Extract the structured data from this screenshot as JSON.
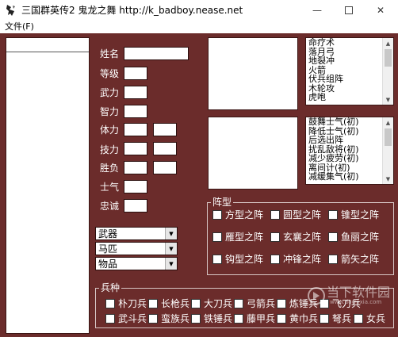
{
  "window": {
    "title": "三国群英传2 鬼龙之舞 http://k_badboy.nease.net",
    "minimize_glyph": "—",
    "close_glyph": "✕"
  },
  "menu": {
    "file_label": "文件(F)"
  },
  "stats": {
    "name_label": "姓名",
    "level_label": "等级",
    "force_label": "武力",
    "intel_label": "智力",
    "hp_label": "体力",
    "skill_label": "技力",
    "winloss_label": "胜负",
    "morale_label": "士气",
    "loyalty_label": "忠诚"
  },
  "combos": [
    {
      "value": "武器"
    },
    {
      "value": "马匹"
    },
    {
      "value": "物品"
    }
  ],
  "skills_list": [
    "命疗术",
    "落月弓",
    "地裂冲",
    "火箭",
    "伏兵组阵",
    "木轮攻",
    "虎咆"
  ],
  "morale_list": [
    "鼓舞士气(初)",
    "降低士气(初)",
    "后选出阵",
    "扰乱敌将(初)",
    "减少疲劳(初)",
    "离间计(初)",
    "减缓集气(初)"
  ],
  "formation": {
    "label": "阵型",
    "items": [
      "方型之阵",
      "圆型之阵",
      "锥型之阵",
      "雁型之阵",
      "玄襄之阵",
      "鱼丽之阵",
      "钩型之阵",
      "冲锋之阵",
      "箭矢之阵"
    ]
  },
  "troops": {
    "label": "兵种",
    "row1": [
      "朴刀兵",
      "长枪兵",
      "大刀兵",
      "弓箭兵",
      "炼锤兵",
      "飞刀兵"
    ],
    "row2": [
      "武斗兵",
      "蛮族兵",
      "铁锤兵",
      "藤甲兵",
      "黄巾兵",
      "弩兵",
      "女兵"
    ]
  },
  "watermark": {
    "text": "当下软件园",
    "url": "www.downxia.com"
  },
  "colors": {
    "client_bg": "#6b2c2b",
    "text_light": "#ffffff"
  }
}
